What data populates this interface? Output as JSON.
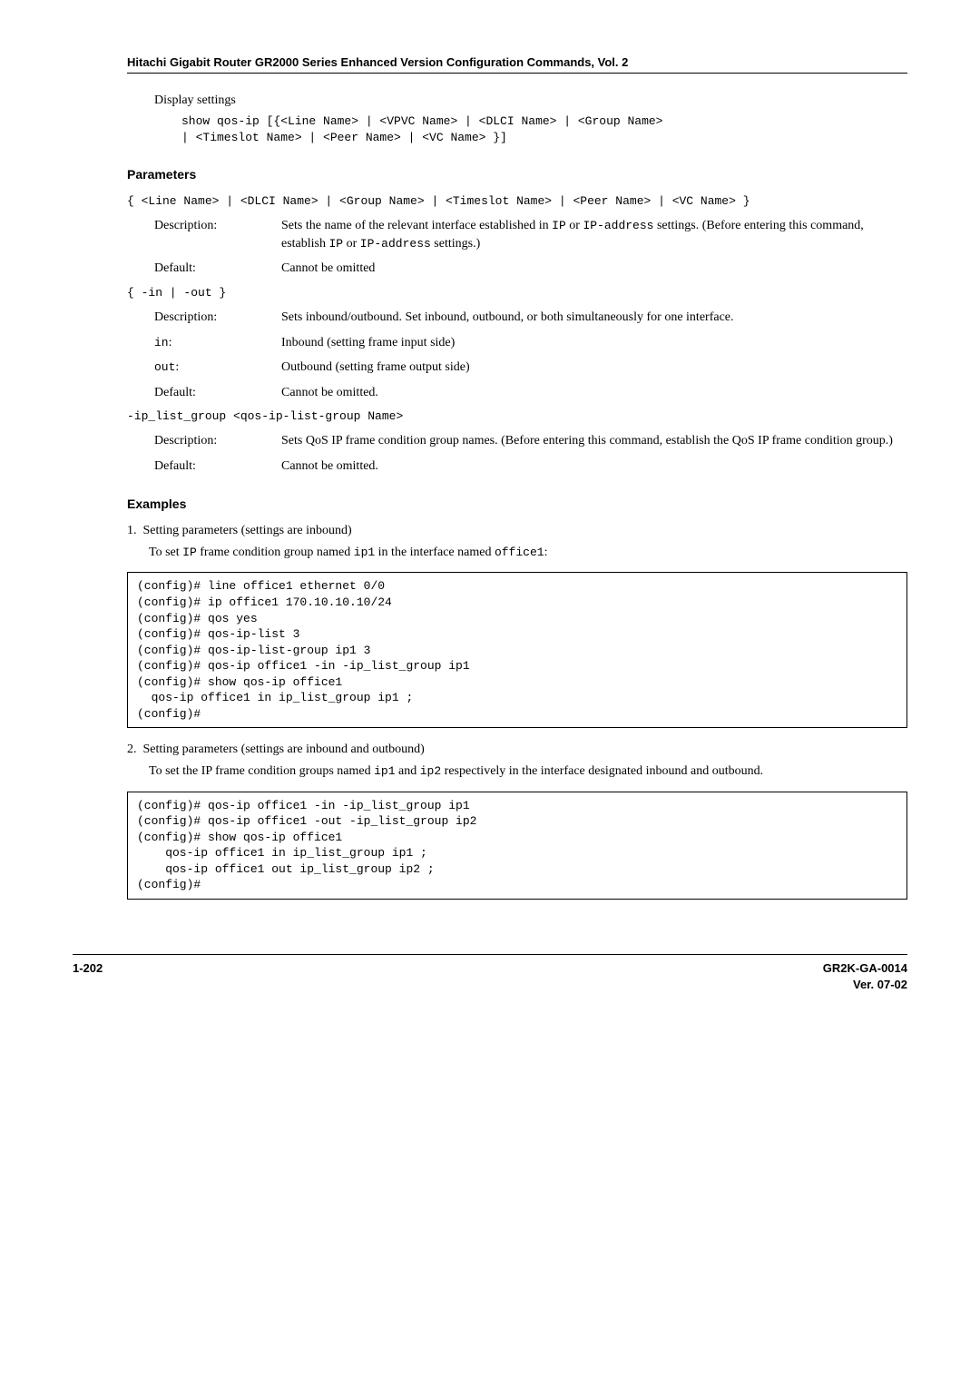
{
  "header": {
    "title": "Hitachi Gigabit Router GR2000 Series Enhanced Version Configuration Commands, Vol. 2"
  },
  "display": {
    "heading": "Display settings",
    "syntax1": "show qos-ip [{<Line Name> | <VPVC Name> | <DLCI Name> | <Group Name>",
    "syntax2": "| <Timeslot Name> | <Peer Name> | <VC Name> }]"
  },
  "params": {
    "title": "Parameters",
    "p1": {
      "line": "{ <Line Name> | <DLCI Name> | <Group Name> | <Timeslot Name> | <Peer Name> | <VC Name> }",
      "desc_label": "Description:",
      "desc": {
        "pre": "Sets the name of the relevant interface established in ",
        "mono1": "IP",
        "mid1": " or ",
        "mono2": "IP-address",
        "mid2": " settings. (Before entering this command, establish ",
        "mono3": "IP",
        "mid3": " or ",
        "mono4": "IP-address",
        "post": " settings.)"
      },
      "default_label": "Default:",
      "default_val": "Cannot be omitted"
    },
    "p2": {
      "line": "{ -in | -out }",
      "desc_label": "Description:",
      "desc": "Sets inbound/outbound. Set inbound, outbound, or both simultaneously for one interface.",
      "in_label": "in",
      "in_colon": ":",
      "in_val": "Inbound (setting frame input side)",
      "out_label": "out",
      "out_colon": ":",
      "out_val": "Outbound (setting frame output side)",
      "default_label": "Default:",
      "default_val": "Cannot be omitted."
    },
    "p3": {
      "line": "-ip_list_group <qos-ip-list-group Name>",
      "desc_label": "Description:",
      "desc": "Sets QoS IP frame condition group names. (Before entering this command, establish the QoS IP frame condition group.)",
      "default_label": "Default:",
      "default_val": "Cannot be omitted."
    }
  },
  "examples": {
    "title": "Examples",
    "e1": {
      "num": "1.",
      "heading": "Setting parameters (settings are inbound)",
      "body_pre": "To set ",
      "body_mono1": "IP",
      "body_mid1": " frame condition group named ",
      "body_mono2": "ip1",
      "body_mid2": " in the interface named ",
      "body_mono3": "office1",
      "body_post": ":",
      "code": "(config)# line office1 ethernet 0/0\n(config)# ip office1 170.10.10.10/24\n(config)# qos yes\n(config)# qos-ip-list 3\n(config)# qos-ip-list-group ip1 3\n(config)# qos-ip office1 -in -ip_list_group ip1\n(config)# show qos-ip office1\n  qos-ip office1 in ip_list_group ip1 ;\n(config)#"
    },
    "e2": {
      "num": "2.",
      "heading": "Setting parameters (settings are inbound and outbound)",
      "body_pre": "To set the IP frame condition groups named ",
      "body_mono1": "ip1",
      "body_mid1": " and ",
      "body_mono2": "ip2",
      "body_post": " respectively in the interface designated inbound and outbound.",
      "code": "(config)# qos-ip office1 -in -ip_list_group ip1\n(config)# qos-ip office1 -out -ip_list_group ip2\n(config)# show qos-ip office1\n    qos-ip office1 in ip_list_group ip1 ;\n    qos-ip office1 out ip_list_group ip2 ;\n(config)#"
    }
  },
  "footer": {
    "left": "1-202",
    "right1": "GR2K-GA-0014",
    "right2": "Ver. 07-02"
  }
}
